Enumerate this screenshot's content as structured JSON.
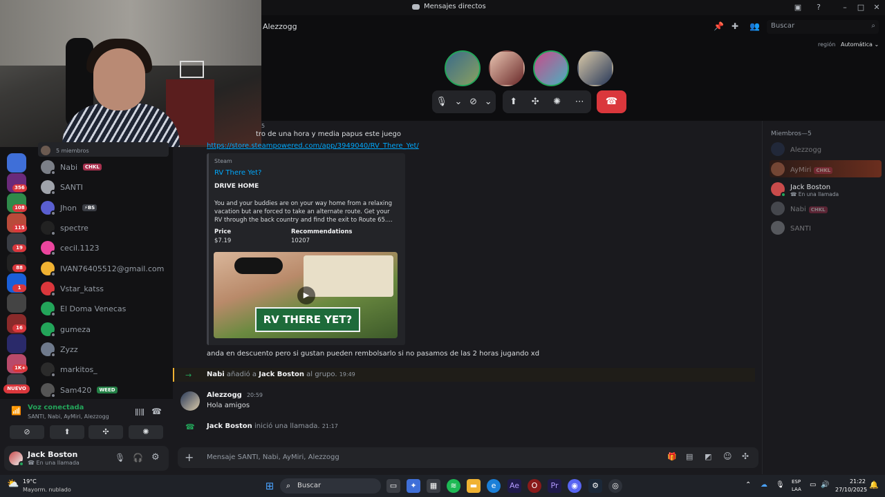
{
  "window": {
    "title": "Mensajes directos"
  },
  "header": {
    "channel": "Alezzogg",
    "search_placeholder": "Buscar",
    "region_label": "región",
    "region_value": "Automática"
  },
  "rail": {
    "badges": [
      "356",
      "108",
      "115",
      "19",
      "88",
      "1",
      "16",
      "1K+"
    ],
    "nuevo": "NUEVO"
  },
  "dms": [
    {
      "name": "5 miembros",
      "tag": "",
      "color": "#6b5a50"
    },
    {
      "name": "Nabi",
      "tag": "CHKL",
      "tag_color": "#a8314f",
      "color": "#7b7f87"
    },
    {
      "name": "SANTI",
      "tag": "",
      "color": "#a0a4ab"
    },
    {
      "name": "Jhon",
      "tag": "⚡BS",
      "tag_color": "#3a3d44",
      "color": "#5a5fd0"
    },
    {
      "name": "spectre",
      "tag": "",
      "color": "#222"
    },
    {
      "name": "cecil.1123",
      "tag": "",
      "color": "#eb459e"
    },
    {
      "name": "IVAN76405512@gmail.com",
      "tag": "",
      "color": "#f0b232"
    },
    {
      "name": "Vstar_katss",
      "tag": "",
      "color": "#da373c"
    },
    {
      "name": "El Doma Venecas",
      "tag": "",
      "color": "#23a55a"
    },
    {
      "name": "gumeza",
      "tag": "",
      "color": "#23a55a"
    },
    {
      "name": "Zyzz",
      "tag": "",
      "color": "#6f7a8c"
    },
    {
      "name": "markitos_",
      "tag": "",
      "color": "#2b2b2b"
    },
    {
      "name": "Sam420",
      "tag": "WEED",
      "tag_color": "#248046",
      "color": "#555"
    }
  ],
  "voice": {
    "status": "Voz conectada",
    "participants": "SANTI, Nabi, AyMiri, Alezzogg"
  },
  "user": {
    "name": "Jack Boston",
    "status": "En una llamada"
  },
  "members": {
    "header": "Miembros—5",
    "list": [
      {
        "name": "Alezzogg",
        "tag": "",
        "status": ""
      },
      {
        "name": "AyMiri",
        "tag": "CHKL",
        "status": ""
      },
      {
        "name": "Jack Boston",
        "tag": "",
        "status": "En una llamada"
      },
      {
        "name": "Nabi",
        "tag": "CHKL",
        "status": ""
      },
      {
        "name": "SANTI",
        "tag": "",
        "status": ""
      }
    ]
  },
  "messages": {
    "top_time": "5",
    "top_text": "tro de una hora y media papus este juego",
    "link": "https://store.steampowered.com/app/3949040/RV_There_Yet/",
    "embed": {
      "provider": "Steam",
      "title": "RV There Yet?",
      "subtitle": "DRIVE HOME",
      "description": "You and your buddies are on your way home from a relaxing vacation but are forced to take an alternate route. Get your RV through the back country and find the exit to Route 65....",
      "price_label": "Price",
      "price_value": "$7.19",
      "rec_label": "Recommendations",
      "rec_value": "10207",
      "image_caption": "RV THERE YET?"
    },
    "msg2": "anda en descuento pero si gustan pueden rembolsarlo si no pasamos de las 2 horas jugando xd",
    "system_add": {
      "actor": "Nabi",
      "verb": "añadió a",
      "target": "Jack Boston",
      "rest": "al grupo.",
      "time": "19:49"
    },
    "msg3": {
      "author": "Alezzogg",
      "time": "20:59",
      "text": "Hola amigos"
    },
    "call": {
      "actor": "Jack Boston",
      "text": "inició una llamada.",
      "time": "21:17"
    }
  },
  "composer": {
    "placeholder": "Mensaje SANTI, Nabi, AyMiri, Alezzogg"
  },
  "taskbar": {
    "weather_temp": "19°C",
    "weather_desc": "Mayorm. nublado",
    "search": "Buscar",
    "lang": "ESP",
    "lang2": "LAA",
    "time": "21:22",
    "date": "27/10/2025"
  }
}
